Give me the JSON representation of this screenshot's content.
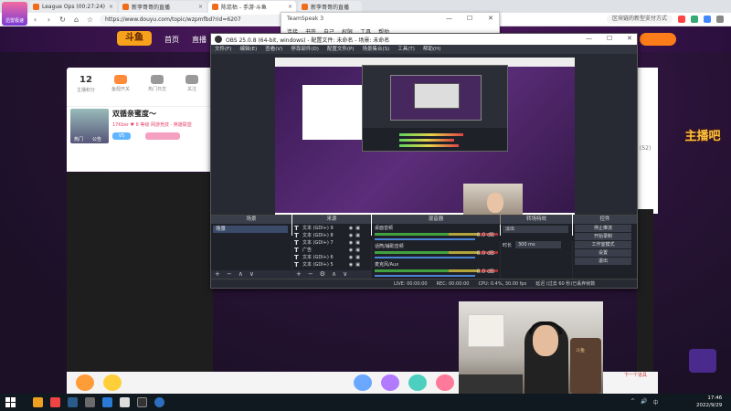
{
  "browser": {
    "logo_label": "迅雷极速",
    "tabs": [
      {
        "title": "League Ops (00:27:24)",
        "active": false
      },
      {
        "title": "新李哥哥的直播",
        "active": false
      },
      {
        "title": "陈蕊枯 - 手游·斗鱼",
        "active": true
      },
      {
        "title": "新李哥哥的直播",
        "active": false
      }
    ],
    "url": "https://www.douyu.com/topic/wzpmfbd?rid=6207",
    "right_search": "区块链的新型支付方式"
  },
  "douyu": {
    "logo": "斗鱼",
    "nav": [
      "首页",
      "直播"
    ],
    "stats": [
      {
        "num": "12",
        "label": "主播积分"
      },
      {
        "label": "鱼翅开关",
        "badge": "3"
      },
      {
        "label": "热门日志"
      },
      {
        "label": "关注"
      }
    ],
    "anchor": {
      "name": "双循亲蜜度～",
      "meta": "17Kber  ♥ 8  等级  网游竞技 · 英雄联盟",
      "badge": "V5",
      "avatar_tags": [
        "热门",
        "公告"
      ]
    },
    "side_logo": "主播吧",
    "right_count": "(52)",
    "side_text": "实人赛门文件",
    "gift_label": "下一个道具"
  },
  "teamspeak": {
    "title": "TeamSpeak 3",
    "menu": [
      "连接",
      "书签",
      "自己",
      "权限",
      "工具",
      "帮助"
    ],
    "close": "✕",
    "max": "☐",
    "min": "—"
  },
  "obs": {
    "title": "OBS 25.0.8 (64-bit, windows) - 配置文件: 未命名 - 场景: 未命名",
    "menu": [
      "文件(F)",
      "编辑(E)",
      "查看(V)",
      "停靠部件(D)",
      "配置文件(P)",
      "场景集合(S)",
      "工具(T)",
      "帮助(H)"
    ],
    "docks": {
      "scenes": {
        "title": "场景",
        "items": [
          "场景"
        ],
        "footer": [
          "+",
          "−",
          "∧",
          "∨"
        ]
      },
      "sources": {
        "title": "来源",
        "items": [
          "文本 (GDI+) 9",
          "文本 (GDI+) 8",
          "文本 (GDI+) 7",
          "广告",
          "文本 (GDI+) 6",
          "文本 (GDI+) 5"
        ],
        "footer": [
          "+",
          "−",
          "⚙",
          "∧",
          "∨"
        ]
      },
      "mixer": {
        "title": "混音器",
        "channels": [
          {
            "name": "桌面音频",
            "vol": "0.0 dB"
          },
          {
            "name": "话筒/辅助音频",
            "vol": "0.0 dB"
          },
          {
            "name": "麦克风/Aux",
            "vol": "0.0 dB"
          }
        ]
      },
      "transitions": {
        "title": "转场特效",
        "select": "淡出",
        "duration_label": "时长",
        "duration": "300 ms"
      },
      "controls": {
        "title": "控件",
        "buttons": [
          "停止推流",
          "开始录制",
          "工作室模式",
          "设置",
          "退出"
        ]
      }
    },
    "status": [
      "LIVE: 00:00:00",
      "REC: 00:00:00",
      "CPU: 0.4%, 30.00 fps",
      "延迟 (过去 60 秒)已丢弃帧数"
    ]
  },
  "webcam": {
    "chair_label": "斗鱼"
  },
  "taskbar": {
    "time": "17:46",
    "date": "2022/9/29",
    "tray": [
      "^",
      "🔊",
      "中"
    ]
  }
}
